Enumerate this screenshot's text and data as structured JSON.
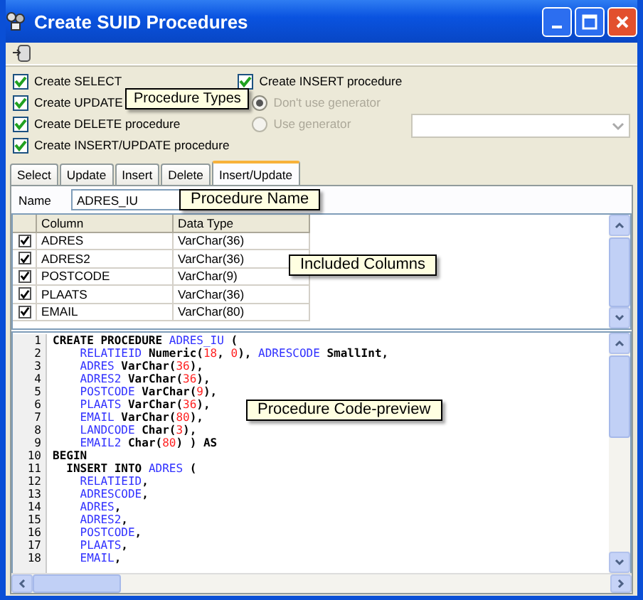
{
  "window": {
    "title": "Create SUID Procedures"
  },
  "options": [
    {
      "label": "Create SELECT",
      "checked": true
    },
    {
      "label": "Create UPDATE",
      "checked": true
    },
    {
      "label": "Create DELETE procedure",
      "checked": true
    },
    {
      "label": "Create INSERT/UPDATE procedure",
      "checked": true
    }
  ],
  "insert_option": {
    "label": "Create INSERT procedure",
    "checked": true
  },
  "generator_options": [
    {
      "label": "Don't use generator",
      "selected": true,
      "disabled": true
    },
    {
      "label": "Use generator",
      "selected": false,
      "disabled": true
    }
  ],
  "tabs": [
    {
      "label": "Select",
      "selected": false
    },
    {
      "label": "Update",
      "selected": false
    },
    {
      "label": "Insert",
      "selected": false
    },
    {
      "label": "Delete",
      "selected": false
    },
    {
      "label": "Insert/Update",
      "selected": true
    }
  ],
  "name_field": {
    "label": "Name",
    "value": "ADRES_IU"
  },
  "table": {
    "columns": [
      "Column",
      "Data Type"
    ],
    "rows": [
      {
        "checked": true,
        "cells": [
          "ADRES",
          "VarChar(36)"
        ]
      },
      {
        "checked": true,
        "cells": [
          "ADRES2",
          "VarChar(36)"
        ]
      },
      {
        "checked": true,
        "cells": [
          "POSTCODE",
          "VarChar(9)"
        ]
      },
      {
        "checked": true,
        "cells": [
          "PLAATS",
          "VarChar(36)"
        ]
      },
      {
        "checked": true,
        "cells": [
          "EMAIL",
          "VarChar(80)"
        ]
      }
    ]
  },
  "code": [
    {
      "num": "1",
      "tokens": [
        {
          "kind": "kw",
          "text": "CREATE PROCEDURE "
        },
        {
          "kind": "id",
          "text": "ADRES_IU"
        },
        {
          "kind": "kw",
          "text": " ("
        }
      ]
    },
    {
      "num": "2",
      "tokens": [
        {
          "kind": "id",
          "text": "    RELATIEID"
        },
        {
          "kind": "kw",
          "text": " Numeric("
        },
        {
          "kind": "num",
          "text": "18"
        },
        {
          "kind": "kw",
          "text": ", "
        },
        {
          "kind": "num",
          "text": "0"
        },
        {
          "kind": "kw",
          "text": "), "
        },
        {
          "kind": "id",
          "text": "ADRESCODE"
        },
        {
          "kind": "kw",
          "text": " SmallInt,"
        }
      ]
    },
    {
      "num": "3",
      "tokens": [
        {
          "kind": "id",
          "text": "    ADRES"
        },
        {
          "kind": "kw",
          "text": " VarChar("
        },
        {
          "kind": "num",
          "text": "36"
        },
        {
          "kind": "kw",
          "text": "),"
        }
      ]
    },
    {
      "num": "4",
      "tokens": [
        {
          "kind": "id",
          "text": "    ADRES2"
        },
        {
          "kind": "kw",
          "text": " VarChar("
        },
        {
          "kind": "num",
          "text": "36"
        },
        {
          "kind": "kw",
          "text": "),"
        }
      ]
    },
    {
      "num": "5",
      "tokens": [
        {
          "kind": "id",
          "text": "    POSTCODE"
        },
        {
          "kind": "kw",
          "text": " VarChar("
        },
        {
          "kind": "num",
          "text": "9"
        },
        {
          "kind": "kw",
          "text": "),"
        }
      ]
    },
    {
      "num": "6",
      "tokens": [
        {
          "kind": "id",
          "text": "    PLAATS"
        },
        {
          "kind": "kw",
          "text": " VarChar("
        },
        {
          "kind": "num",
          "text": "36"
        },
        {
          "kind": "kw",
          "text": "),"
        }
      ]
    },
    {
      "num": "7",
      "tokens": [
        {
          "kind": "id",
          "text": "    EMAIL"
        },
        {
          "kind": "kw",
          "text": " VarChar("
        },
        {
          "kind": "num",
          "text": "80"
        },
        {
          "kind": "kw",
          "text": "),"
        }
      ]
    },
    {
      "num": "8",
      "tokens": [
        {
          "kind": "id",
          "text": "    LANDCODE"
        },
        {
          "kind": "kw",
          "text": " Char("
        },
        {
          "kind": "num",
          "text": "3"
        },
        {
          "kind": "kw",
          "text": "),"
        }
      ]
    },
    {
      "num": "9",
      "tokens": [
        {
          "kind": "id",
          "text": "    EMAIL2"
        },
        {
          "kind": "kw",
          "text": " Char("
        },
        {
          "kind": "num",
          "text": "80"
        },
        {
          "kind": "kw",
          "text": ") ) AS"
        }
      ]
    },
    {
      "num": "10",
      "tokens": [
        {
          "kind": "kw",
          "text": "BEGIN"
        }
      ]
    },
    {
      "num": "11",
      "tokens": [
        {
          "kind": "kw",
          "text": "  INSERT INTO "
        },
        {
          "kind": "id",
          "text": "ADRES"
        },
        {
          "kind": "kw",
          "text": " ("
        }
      ]
    },
    {
      "num": "12",
      "tokens": [
        {
          "kind": "id",
          "text": "    RELATIEID"
        },
        {
          "kind": "kw",
          "text": ","
        }
      ]
    },
    {
      "num": "13",
      "tokens": [
        {
          "kind": "id",
          "text": "    ADRESCODE"
        },
        {
          "kind": "kw",
          "text": ","
        }
      ]
    },
    {
      "num": "14",
      "tokens": [
        {
          "kind": "id",
          "text": "    ADRES"
        },
        {
          "kind": "kw",
          "text": ","
        }
      ]
    },
    {
      "num": "15",
      "tokens": [
        {
          "kind": "id",
          "text": "    ADRES2"
        },
        {
          "kind": "kw",
          "text": ","
        }
      ]
    },
    {
      "num": "16",
      "tokens": [
        {
          "kind": "id",
          "text": "    POSTCODE"
        },
        {
          "kind": "kw",
          "text": ","
        }
      ]
    },
    {
      "num": "17",
      "tokens": [
        {
          "kind": "id",
          "text": "    PLAATS"
        },
        {
          "kind": "kw",
          "text": ","
        }
      ]
    },
    {
      "num": "18",
      "tokens": [
        {
          "kind": "id",
          "text": "    EMAIL"
        },
        {
          "kind": "kw",
          "text": ","
        }
      ]
    }
  ],
  "callouts": [
    {
      "kind": "types",
      "text": "Procedure Types"
    },
    {
      "kind": "name",
      "text": "Procedure Name"
    },
    {
      "kind": "columns",
      "text": "Included Columns"
    },
    {
      "kind": "code",
      "text": "Procedure Code-preview"
    }
  ]
}
